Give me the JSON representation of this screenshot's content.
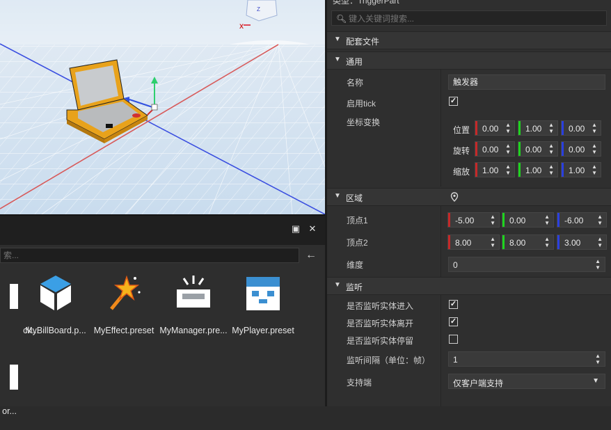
{
  "properties": {
    "type_row": "类型：TriggerPart",
    "search_placeholder": "键入关键词搜索...",
    "sections": {
      "config_file": "配套文件",
      "general": "通用",
      "area": "区域",
      "listen": "监听"
    },
    "general": {
      "name_label": "名称",
      "name_value": "触发器",
      "enable_tick_label": "启用tick",
      "enable_tick_checked": true,
      "transform_label": "坐标变换",
      "position_label": "位置",
      "position": [
        "0.00",
        "1.00",
        "0.00"
      ],
      "rotation_label": "旋转",
      "rotation": [
        "0.00",
        "0.00",
        "0.00"
      ],
      "scale_label": "缩放",
      "scale": [
        "1.00",
        "1.00",
        "1.00"
      ]
    },
    "area": {
      "vertex1_label": "顶点1",
      "vertex1": [
        "-5.00",
        "0.00",
        "-6.00"
      ],
      "vertex2_label": "顶点2",
      "vertex2": [
        "8.00",
        "8.00",
        "3.00"
      ],
      "dimension_label": "维度",
      "dimension_value": "0"
    },
    "listen": {
      "enter_label": "是否监听实体进入",
      "enter_checked": true,
      "leave_label": "是否监听实体离开",
      "leave_checked": true,
      "stay_label": "是否监听实体停留",
      "stay_checked": false,
      "interval_label": "监听间隔（单位：帧）",
      "interval_value": "1",
      "support_label": "支持端",
      "support_value": "仅客户端支持"
    }
  },
  "resources": {
    "search_placeholder": "索...",
    "assets": [
      {
        "label": "ck...",
        "icon": "partial-asset-icon"
      },
      {
        "label": "MyBillBoard.p...",
        "icon": "billboard-cube-icon"
      },
      {
        "label": "MyEffect.preset",
        "icon": "magic-wand-icon"
      },
      {
        "label": "MyManager.pre...",
        "icon": "manager-tray-icon"
      },
      {
        "label": "MyPlayer.preset",
        "icon": "player-face-icon"
      }
    ],
    "second_row_label": "or..."
  },
  "viewport": {
    "gizmo_z": "Z",
    "gizmo_x": "X"
  },
  "colors": {
    "axis_x": "#d32f2f",
    "axis_y": "#22c322",
    "axis_z": "#2a3fe0",
    "trigger_box": "#e5a219"
  }
}
